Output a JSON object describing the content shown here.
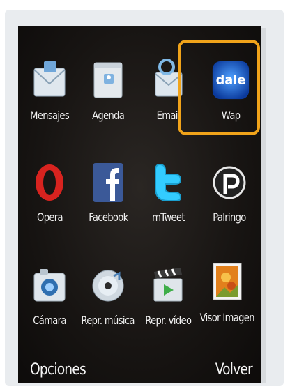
{
  "apps": [
    {
      "label": "Mensajes",
      "icon": "envelope-icon"
    },
    {
      "label": "Agenda",
      "icon": "contacts-folder-icon"
    },
    {
      "label": "Email",
      "icon": "email-at-icon"
    },
    {
      "label": "Wap",
      "icon": "dale-wap-icon",
      "badge": "dale",
      "highlighted": true
    },
    {
      "label": "Opera",
      "icon": "opera-icon"
    },
    {
      "label": "Facebook",
      "icon": "facebook-icon"
    },
    {
      "label": "mTweet",
      "icon": "twitter-bird-icon"
    },
    {
      "label": "Palringo",
      "icon": "palringo-icon"
    },
    {
      "label": "Cámara",
      "icon": "camera-icon"
    },
    {
      "label": "Repr. música",
      "icon": "music-disc-icon"
    },
    {
      "label": "Repr. vídeo",
      "icon": "video-clapper-icon"
    },
    {
      "label": "Visor Imagen",
      "icon": "image-viewer-icon"
    }
  ],
  "softkeys": {
    "left": "Opciones",
    "right": "Volver"
  },
  "colors": {
    "highlight": "#f0a31a",
    "facebook": "#3b5998",
    "opera": "#d8231f",
    "twitter": "#33ccff"
  }
}
